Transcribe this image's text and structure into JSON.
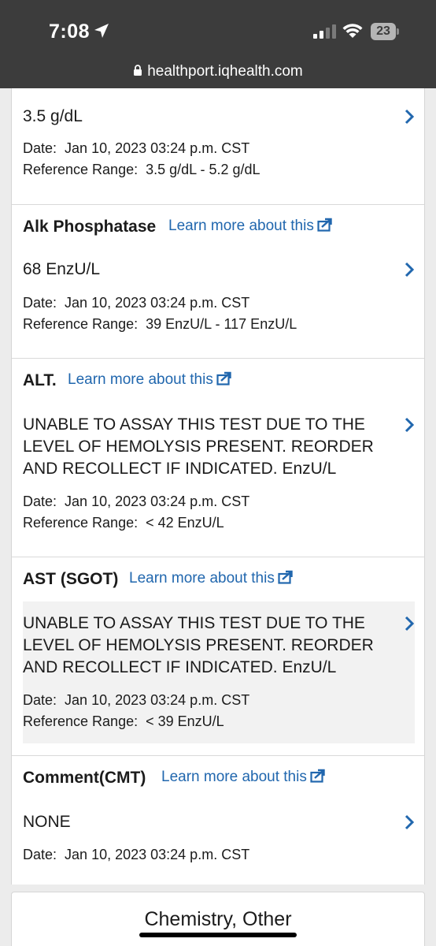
{
  "status_bar": {
    "time": "7:08",
    "battery": "23",
    "url": "healthport.iqhealth.com"
  },
  "results": [
    {
      "title": "",
      "value": "3.5 g/dL",
      "date_label": "Date:",
      "date": "Jan 10, 2023 03:24 p.m. CST",
      "range_label": "Reference Range:",
      "range": "3.5 g/dL - 5.2 g/dL"
    },
    {
      "title": "Alk Phosphatase",
      "link": "Learn more about this",
      "value": "68 EnzU/L",
      "date_label": "Date:",
      "date": "Jan 10, 2023 03:24 p.m. CST",
      "range_label": "Reference Range:",
      "range": "39 EnzU/L - 117 EnzU/L"
    },
    {
      "title": "ALT.",
      "link": "Learn more about this",
      "value_lines": [
        "UNABLE TO ASSAY THIS TEST DUE TO THE",
        "LEVEL OF HEMOLYSIS PRESENT. REORDER",
        "AND RECOLLECT IF INDICATED. EnzU/L"
      ],
      "date_label": "Date:",
      "date": "Jan 10, 2023 03:24 p.m. CST",
      "range_label": "Reference Range:",
      "range": "< 42 EnzU/L"
    },
    {
      "title": "AST (SGOT)",
      "link": "Learn more about this",
      "value_lines": [
        "UNABLE TO ASSAY THIS TEST DUE TO THE",
        "LEVEL OF HEMOLYSIS PRESENT. REORDER",
        "AND RECOLLECT IF INDICATED. EnzU/L"
      ],
      "date_label": "Date:",
      "date": "Jan 10, 2023 03:24 p.m. CST",
      "range_label": "Reference Range:",
      "range": "< 39 EnzU/L"
    },
    {
      "title": "Comment(CMT)",
      "link": "Learn more about this",
      "value": "NONE",
      "date_label": "Date:",
      "date": "Jan 10, 2023 03:24 p.m. CST"
    }
  ],
  "next_section": {
    "title": "Chemistry, Other"
  },
  "colors": {
    "link": "#2167ae",
    "status_bar": "#3c3c3c",
    "highlight": "#f2f2f2"
  },
  "icons": [
    "location-arrow-icon",
    "signal-icon",
    "wifi-icon",
    "lock-icon",
    "external-link-icon",
    "chevron-right-icon"
  ]
}
